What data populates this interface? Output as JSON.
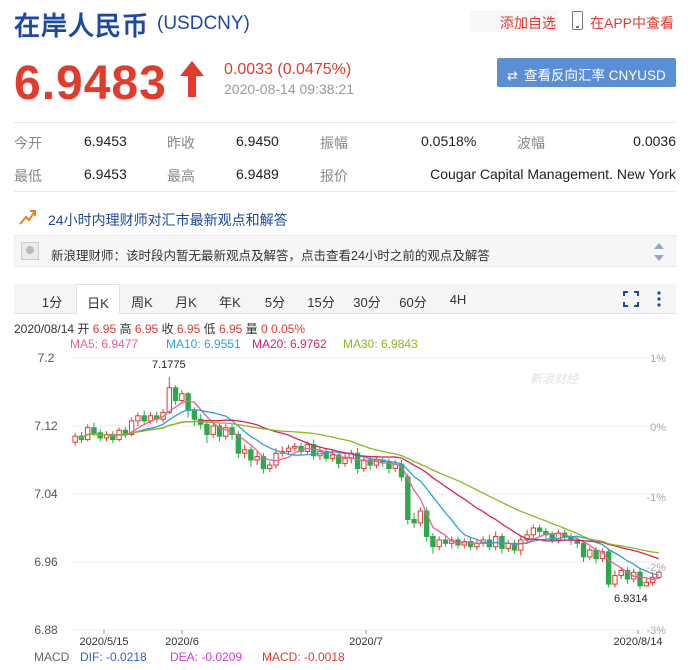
{
  "header": {
    "title": "在岸人民币",
    "symbol": "(USDCNY)",
    "add_favorite": "添加自选",
    "view_in_app": "在APP中查看"
  },
  "quote": {
    "price": "6.9483",
    "change": "0.0033 (0.0475%)",
    "time": "2020-08-14 09:38:21",
    "reverse_button": "查看反向汇率 CNYUSD",
    "up_color": "#e33a2b",
    "direction": "up-arrow-icon"
  },
  "stats": {
    "row1": [
      {
        "label": "今开",
        "value": "6.9453"
      },
      {
        "label": "昨收",
        "value": "6.9450"
      },
      {
        "label": "振幅",
        "value": "0.0518%"
      },
      {
        "label": "波幅",
        "value": "0.0036"
      }
    ],
    "row2": [
      {
        "label": "最低",
        "value": "6.9453"
      },
      {
        "label": "最高",
        "value": "6.9489"
      },
      {
        "label": "报价",
        "value": "Cougar Capital Management. New York"
      }
    ]
  },
  "views": {
    "title": "24小时内理财师对汇市最新观点和解答",
    "notice": "新浪理财师：该时段内暂无最新观点及解答，点击查看24小时之前的观点及解答"
  },
  "tabs": [
    "1分",
    "日K",
    "周K",
    "月K",
    "年K",
    "5分",
    "15分",
    "30分",
    "60分",
    "4H"
  ],
  "active_tab": "日K",
  "ohlc": {
    "date": "2020/08/14",
    "open_label": "开",
    "open": "6.95",
    "high_label": "高",
    "high": "6.95",
    "close_label": "收",
    "close": "6.95",
    "low_label": "低",
    "low": "6.95",
    "volume_label": "量",
    "volume": "0",
    "pct": "0.05%"
  },
  "ma": [
    {
      "label": "MA5: 6.9477",
      "color": "#e8609b"
    },
    {
      "label": "MA10: 6.9551",
      "color": "#2aa3d8"
    },
    {
      "label": "MA20: 6.9762",
      "color": "#d8255c"
    },
    {
      "label": "MA30: 6.9843",
      "color": "#8aba21"
    }
  ],
  "watermark": "新浪财经",
  "macd": {
    "label": "MACD",
    "dif": "DIF: -0.0218",
    "dea": "DEA: -0.0209",
    "macd": "MACD: -0.0018"
  },
  "chart_data": {
    "type": "candlestick",
    "y_ticks": [
      "7.2",
      "7.12",
      "7.04",
      "6.96",
      "6.88"
    ],
    "y_right_ticks": [
      "1%",
      "0%",
      "-1%",
      "-2%",
      "-3%"
    ],
    "x_ticks": [
      "2020/5/15",
      "2020/6",
      "2020/7",
      "2020/8/14"
    ],
    "ylim": [
      6.88,
      7.2
    ],
    "annotations": [
      {
        "label": "7.1775",
        "value": 7.1775
      },
      {
        "label": "6.9314",
        "value": 6.9314
      }
    ],
    "candles": [
      [
        7.101,
        7.108,
        7.112,
        7.097
      ],
      [
        7.108,
        7.104,
        7.113,
        7.1
      ],
      [
        7.104,
        7.118,
        7.122,
        7.102
      ],
      [
        7.118,
        7.112,
        7.124,
        7.108
      ],
      [
        7.112,
        7.106,
        7.116,
        7.102
      ],
      [
        7.106,
        7.11,
        7.114,
        7.102
      ],
      [
        7.11,
        7.104,
        7.114,
        7.1
      ],
      [
        7.104,
        7.115,
        7.118,
        7.102
      ],
      [
        7.115,
        7.11,
        7.119,
        7.106
      ],
      [
        7.11,
        7.126,
        7.13,
        7.108
      ],
      [
        7.126,
        7.132,
        7.136,
        7.12
      ],
      [
        7.132,
        7.126,
        7.138,
        7.122
      ],
      [
        7.126,
        7.132,
        7.136,
        7.122
      ],
      [
        7.132,
        7.128,
        7.137,
        7.124
      ],
      [
        7.128,
        7.136,
        7.14,
        7.124
      ],
      [
        7.136,
        7.165,
        7.1775,
        7.134
      ],
      [
        7.165,
        7.15,
        7.168,
        7.145
      ],
      [
        7.15,
        7.158,
        7.162,
        7.146
      ],
      [
        7.158,
        7.138,
        7.16,
        7.13
      ],
      [
        7.138,
        7.128,
        7.142,
        7.12
      ],
      [
        7.128,
        7.122,
        7.134,
        7.116
      ],
      [
        7.122,
        7.11,
        7.124,
        7.1
      ],
      [
        7.11,
        7.12,
        7.124,
        7.106
      ],
      [
        7.12,
        7.108,
        7.124,
        7.102
      ],
      [
        7.108,
        7.118,
        7.122,
        7.104
      ],
      [
        7.118,
        7.11,
        7.122,
        7.104
      ],
      [
        7.11,
        7.088,
        7.114,
        7.082
      ],
      [
        7.088,
        7.092,
        7.098,
        7.082
      ],
      [
        7.092,
        7.08,
        7.096,
        7.072
      ],
      [
        7.08,
        7.084,
        7.09,
        7.074
      ],
      [
        7.084,
        7.07,
        7.088,
        7.064
      ],
      [
        7.07,
        7.074,
        7.078,
        7.066
      ],
      [
        7.074,
        7.088,
        7.094,
        7.07
      ],
      [
        7.088,
        7.09,
        7.096,
        7.084
      ],
      [
        7.09,
        7.094,
        7.098,
        7.086
      ],
      [
        7.094,
        7.096,
        7.1,
        7.09
      ],
      [
        7.096,
        7.09,
        7.1,
        7.086
      ],
      [
        7.09,
        7.098,
        7.102,
        7.086
      ],
      [
        7.098,
        7.085,
        7.104,
        7.08
      ],
      [
        7.085,
        7.09,
        7.096,
        7.08
      ],
      [
        7.09,
        7.082,
        7.094,
        7.078
      ],
      [
        7.082,
        7.086,
        7.092,
        7.078
      ],
      [
        7.086,
        7.076,
        7.09,
        7.07
      ],
      [
        7.076,
        7.082,
        7.088,
        7.072
      ],
      [
        7.082,
        7.088,
        7.092,
        7.076
      ],
      [
        7.088,
        7.07,
        7.094,
        7.064
      ],
      [
        7.07,
        7.08,
        7.084,
        7.066
      ],
      [
        7.08,
        7.074,
        7.084,
        7.068
      ],
      [
        7.074,
        7.08,
        7.084,
        7.07
      ],
      [
        7.08,
        7.078,
        7.084,
        7.072
      ],
      [
        7.078,
        7.07,
        7.082,
        7.064
      ],
      [
        7.07,
        7.075,
        7.08,
        7.066
      ],
      [
        7.075,
        7.06,
        7.08,
        7.055
      ],
      [
        7.06,
        7.01,
        7.064,
        7.004
      ],
      [
        7.01,
        7.006,
        7.018,
        7.0
      ],
      [
        7.006,
        7.02,
        7.024,
        7.002
      ],
      [
        7.02,
        6.99,
        7.024,
        6.984
      ],
      [
        6.99,
        6.978,
        6.994,
        6.97
      ],
      [
        6.978,
        6.986,
        6.99,
        6.974
      ],
      [
        6.986,
        6.982,
        6.992,
        6.978
      ],
      [
        6.982,
        6.986,
        6.99,
        6.976
      ],
      [
        6.986,
        6.98,
        6.99,
        6.976
      ],
      [
        6.98,
        6.984,
        6.988,
        6.976
      ],
      [
        6.984,
        6.978,
        6.988,
        6.974
      ],
      [
        6.978,
        6.982,
        6.986,
        6.974
      ],
      [
        6.982,
        6.986,
        6.99,
        6.978
      ],
      [
        6.986,
        6.978,
        6.992,
        6.974
      ],
      [
        6.978,
        6.99,
        6.996,
        6.974
      ],
      [
        6.99,
        6.976,
        6.994,
        6.97
      ],
      [
        6.976,
        6.982,
        6.986,
        6.972
      ],
      [
        6.982,
        6.974,
        6.986,
        6.97
      ],
      [
        6.974,
        6.986,
        6.99,
        6.968
      ],
      [
        6.986,
        6.992,
        6.998,
        6.982
      ],
      [
        6.992,
        7.0,
        7.004,
        6.988
      ],
      [
        7.0,
        6.996,
        7.004,
        6.99
      ],
      [
        6.996,
        6.992,
        7.0,
        6.986
      ],
      [
        6.992,
        6.986,
        6.996,
        6.982
      ],
      [
        6.986,
        6.994,
        6.998,
        6.982
      ],
      [
        6.994,
        6.99,
        6.998,
        6.986
      ],
      [
        6.99,
        6.986,
        6.994,
        6.98
      ],
      [
        6.986,
        6.982,
        6.99,
        6.976
      ],
      [
        6.982,
        6.966,
        6.986,
        6.96
      ],
      [
        6.966,
        6.974,
        6.978,
        6.962
      ],
      [
        6.974,
        6.964,
        6.978,
        6.958
      ],
      [
        6.964,
        6.972,
        6.976,
        6.96
      ],
      [
        6.972,
        6.934,
        6.976,
        6.93
      ],
      [
        6.934,
        6.944,
        6.95,
        6.93
      ],
      [
        6.944,
        6.95,
        6.954,
        6.94
      ],
      [
        6.95,
        6.94,
        6.954,
        6.934
      ],
      [
        6.94,
        6.948,
        6.952,
        6.936
      ],
      [
        6.948,
        6.932,
        6.952,
        6.928
      ],
      [
        6.932,
        6.936,
        6.942,
        6.9314
      ],
      [
        6.936,
        6.942,
        6.948,
        6.932
      ],
      [
        6.942,
        6.948,
        6.95,
        6.94
      ]
    ]
  }
}
